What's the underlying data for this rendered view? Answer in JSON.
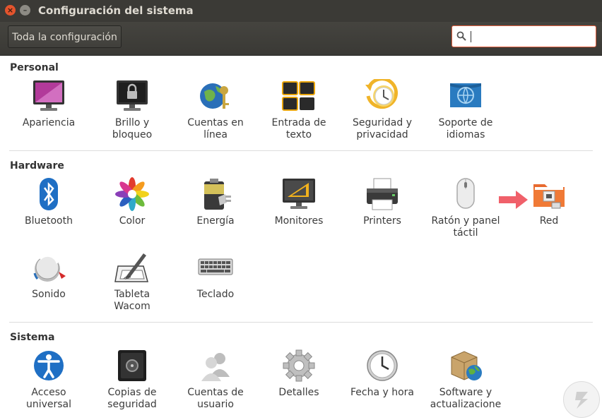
{
  "window": {
    "title": "Configuración del sistema"
  },
  "toolbar": {
    "all_settings_label": "Toda la configuración",
    "search_value": ""
  },
  "sections": {
    "personal": {
      "title": "Personal"
    },
    "hardware": {
      "title": "Hardware"
    },
    "sistema": {
      "title": "Sistema"
    }
  },
  "items": {
    "apariencia": "Apariencia",
    "brillo": "Brillo y\nbloqueo",
    "cuentas_linea": "Cuentas en\nlínea",
    "entrada_texto": "Entrada de\ntexto",
    "seguridad": "Seguridad y\nprivacidad",
    "soporte_idiomas": "Soporte de\nidiomas",
    "bluetooth": "Bluetooth",
    "color": "Color",
    "energia": "Energía",
    "monitores": "Monitores",
    "printers": "Printers",
    "raton": "Ratón y panel\ntáctil",
    "red": "Red",
    "sonido": "Sonido",
    "tableta": "Tableta\nWacom",
    "teclado": "Teclado",
    "acceso": "Acceso\nuniversal",
    "copias": "Copias de\nseguridad",
    "cuentas_usuario": "Cuentas de\nusuario",
    "detalles": "Detalles",
    "fecha": "Fecha y hora",
    "software": "Software y\nactualizacione"
  },
  "colors": {
    "titlebar": "#3b3a36",
    "accent": "#e15c3b",
    "arrow": "#f0606a"
  }
}
